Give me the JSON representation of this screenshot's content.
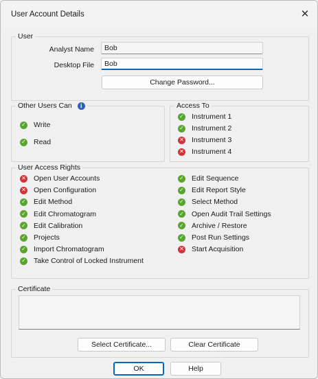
{
  "window": {
    "title": "User Account Details",
    "close_glyph": "✕"
  },
  "user": {
    "legend": "User",
    "analyst_name_label": "Analyst Name",
    "analyst_name_value": "Bob",
    "desktop_file_label": "Desktop File",
    "desktop_file_value": "Bob",
    "change_password_label": "Change Password..."
  },
  "other_users": {
    "legend": "Other Users Can",
    "info_icon": "info-icon",
    "items": [
      {
        "label": "Write",
        "status": "allowed"
      },
      {
        "label": "Read",
        "status": "allowed"
      }
    ]
  },
  "access_to": {
    "legend": "Access To",
    "items": [
      {
        "label": "Instrument 1",
        "status": "allowed"
      },
      {
        "label": "Instrument 2",
        "status": "allowed"
      },
      {
        "label": "Instrument 3",
        "status": "denied"
      },
      {
        "label": "Instrument 4",
        "status": "denied"
      }
    ]
  },
  "access_rights": {
    "legend": "User Access Rights",
    "left": [
      {
        "label": "Open User Accounts",
        "status": "denied"
      },
      {
        "label": "Open Configuration",
        "status": "denied"
      },
      {
        "label": "Edit Method",
        "status": "allowed"
      },
      {
        "label": "Edit Chromatogram",
        "status": "allowed"
      },
      {
        "label": "Edit Calibration",
        "status": "allowed"
      },
      {
        "label": "Projects",
        "status": "allowed"
      },
      {
        "label": "Import Chromatogram",
        "status": "allowed"
      },
      {
        "label": "Take Control of Locked Instrument",
        "status": "allowed"
      }
    ],
    "right": [
      {
        "label": "Edit Sequence",
        "status": "allowed"
      },
      {
        "label": "Edit Report Style",
        "status": "allowed"
      },
      {
        "label": "Select Method",
        "status": "allowed"
      },
      {
        "label": "Open Audit Trail Settings",
        "status": "allowed"
      },
      {
        "label": "Archive / Restore",
        "status": "allowed"
      },
      {
        "label": "Post Run Settings",
        "status": "allowed"
      },
      {
        "label": "Start Acquisition",
        "status": "denied"
      }
    ]
  },
  "certificate": {
    "legend": "Certificate",
    "value": "",
    "select_label": "Select Certificate...",
    "clear_label": "Clear Certificate"
  },
  "footer": {
    "ok_label": "OK",
    "help_label": "Help"
  },
  "colors": {
    "allowed": "#59a62d",
    "denied": "#d13438",
    "info": "#2a64b8",
    "accent": "#0067c0"
  },
  "icons": {
    "allowed": "check-circle-icon",
    "denied": "x-circle-icon"
  }
}
